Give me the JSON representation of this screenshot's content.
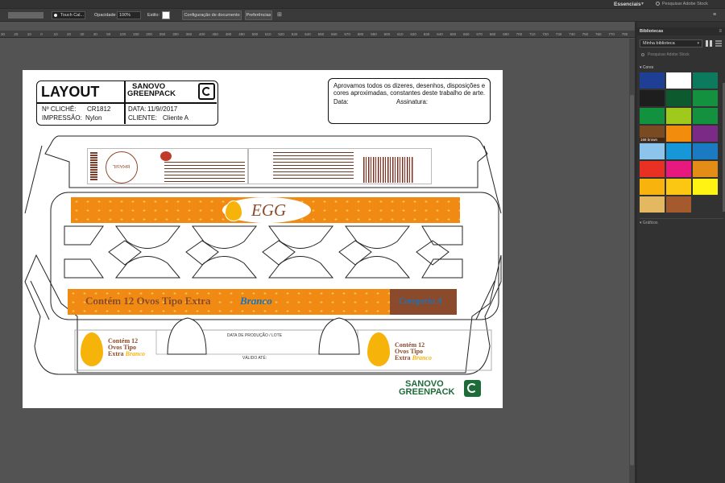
{
  "topbar": {
    "workspace": "Essenciais",
    "stock_placeholder": "Pesquisar Adobe Stock"
  },
  "control_bar": {
    "brush": "Touch Cal...",
    "opacity_label": "Opacidade",
    "opacity_value": "100%",
    "style_label": "Estilo:",
    "doc_setup_button": "Configuração de documento",
    "prefs_button": "Preferências"
  },
  "ruler": {
    "ticks": [
      "30",
      "20",
      "10",
      "0",
      "10",
      "20",
      "30",
      "40",
      "50",
      "100",
      "150",
      "200",
      "250",
      "300",
      "350",
      "400",
      "450",
      "480",
      "490",
      "500",
      "510",
      "520",
      "530",
      "540",
      "550",
      "560",
      "570",
      "580",
      "590",
      "600",
      "610",
      "620",
      "630",
      "640",
      "650",
      "660",
      "670",
      "680",
      "690",
      "700",
      "710",
      "720",
      "730",
      "740",
      "750",
      "760",
      "770",
      "780"
    ]
  },
  "libraries_panel": {
    "title": "Bibliotecas",
    "library_name": "Minha biblioteca",
    "search_placeholder": "Pesquisar Adobe Stock",
    "colors_section": "Cores",
    "second_section": "Gráficos",
    "tooltip": "168 brown",
    "swatches": [
      "#1f3f94",
      "#ffffff",
      "#0b7a5d",
      "#1e1e1e",
      "#0e5a2f",
      "#13913e",
      "#12913f",
      "#9fc91b",
      "#13913e",
      "#7a4a23",
      "#f28c0c",
      "#7b2a86",
      "#8cc4ec",
      "#1796d8",
      "#1a7bc2",
      "#e83122",
      "#e8197e",
      "#e38c16",
      "#f8b40c",
      "#fcc712",
      "#fff314",
      "#e4b860",
      "#a55a2e"
    ]
  },
  "artwork": {
    "layout_title": "LAYOUT",
    "brand_line1": "SANOVO",
    "brand_line2": "GREENPACK",
    "cliche_label": "Nº CLICHÊ:",
    "cliche_value": "CR1812",
    "impressao_label": "IMPRESSÃO:",
    "impressao_value": "Nylon",
    "data_label": "DATA:",
    "data_value": "11/9//2017",
    "cliente_label": "CLIENTE:",
    "cliente_value": "Cliente A",
    "approval_text": "Aprovamos todos os dizeres, desenhos, disposições e cores aproximadas, constantes deste trabalho de arte.",
    "approval_date": "Data:",
    "approval_sign": "Assinatura:",
    "egg_word": "EGG",
    "banner_text": "Contém 12 Ovos Tipo Extra",
    "banner_accent": "Branco",
    "category_text": "Categoria A",
    "side_line1": "Contém 12",
    "side_line2": "Ovos Tipo",
    "side_line3": "Extra",
    "side_accent": "Branco",
    "production_label": "DATA DE PRODUÇÃO / LOTE",
    "validity_label": "VÁLIDO ATÉ:",
    "stamp_text": "BRASIL",
    "footer_line1": "SANOVO",
    "footer_line2": "GREENPACK"
  },
  "colors": {
    "orange": "#f08a12",
    "brown": "#8b4a2b",
    "yellow": "#f6b40a",
    "green": "#1e6b3a",
    "blue": "#1a73b8"
  }
}
